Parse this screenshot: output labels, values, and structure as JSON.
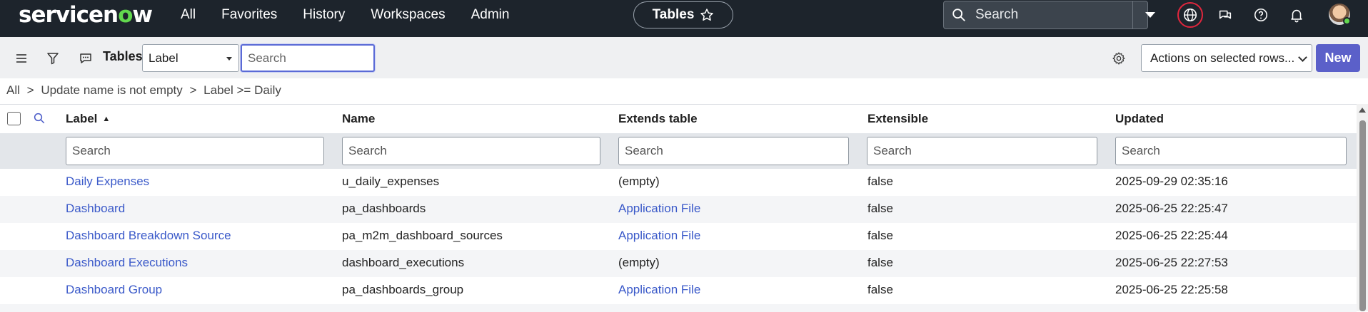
{
  "app": {
    "logo": {
      "pre": "servicen",
      "o": "o",
      "post": "w"
    },
    "nav": [
      "All",
      "Favorites",
      "History",
      "Workspaces",
      "Admin"
    ],
    "context_pill": "Tables",
    "global_search_placeholder": "Search"
  },
  "listbar": {
    "title": "Tables",
    "search_field": "Label",
    "search_placeholder": "Search",
    "actions_label": "Actions on selected rows...",
    "new_label": "New"
  },
  "breadcrumb": [
    "All",
    "Update name is not empty",
    "Label >= Daily"
  ],
  "breadcrumb_sep": ">",
  "table": {
    "columns": [
      "Label",
      "Name",
      "Extends table",
      "Extensible",
      "Updated"
    ],
    "sort_indicator": "▲",
    "filter_placeholder": "Search",
    "rows": [
      {
        "label": "Daily Expenses",
        "name": "u_daily_expenses",
        "extends": "(empty)",
        "extensible": "false",
        "updated": "2025-09-29 02:35:16"
      },
      {
        "label": "Dashboard",
        "name": "pa_dashboards",
        "extends": "Application File",
        "extensible": "false",
        "updated": "2025-06-25 22:25:47"
      },
      {
        "label": "Dashboard Breakdown Source",
        "name": "pa_m2m_dashboard_sources",
        "extends": "Application File",
        "extensible": "false",
        "updated": "2025-06-25 22:25:44"
      },
      {
        "label": "Dashboard Executions",
        "name": "dashboard_executions",
        "extends": "(empty)",
        "extensible": "false",
        "updated": "2025-06-25 22:27:53"
      },
      {
        "label": "Dashboard Group",
        "name": "pa_dashboards_group",
        "extends": "Application File",
        "extensible": "false",
        "updated": "2025-06-25 22:25:58"
      }
    ]
  },
  "colors": {
    "nav_bg": "#1d242c",
    "accent": "#5b60c9",
    "link": "#3a59c9",
    "logo_o": "#62d84e"
  }
}
